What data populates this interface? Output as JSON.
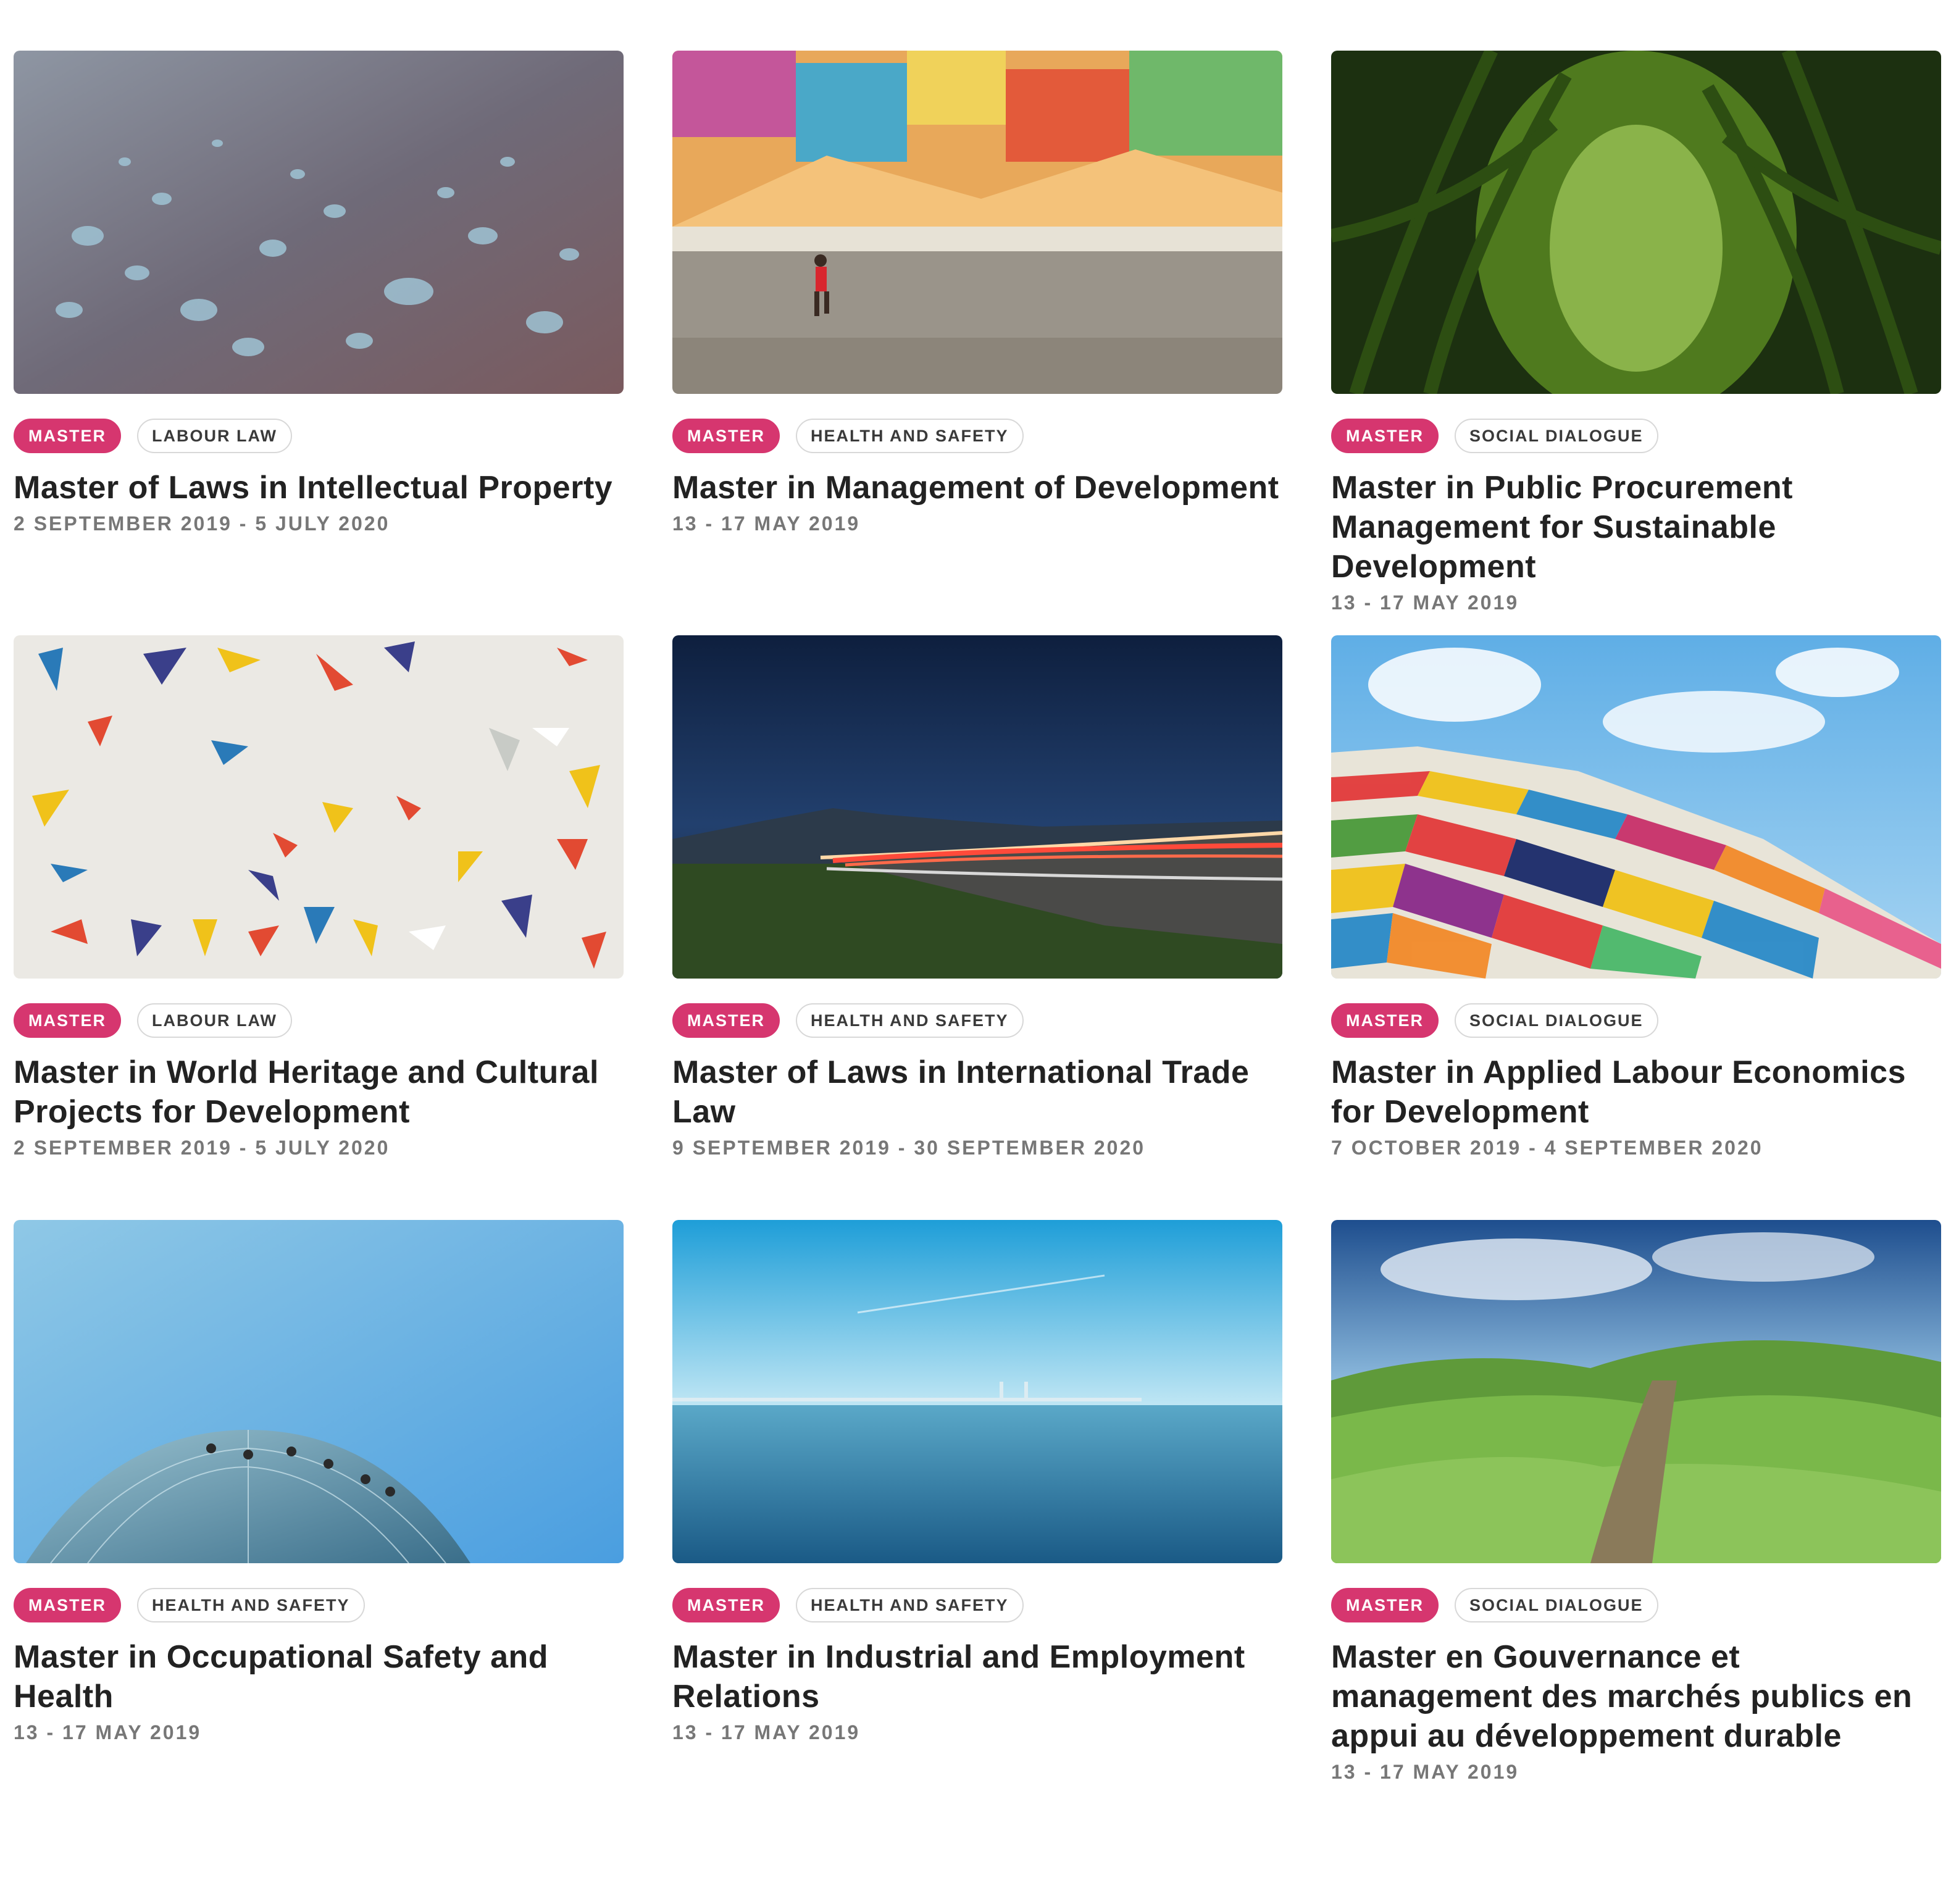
{
  "courses": [
    {
      "image": "water-droplets-image",
      "tags": [
        "MASTER",
        "LABOUR LAW"
      ],
      "title": "Master of Laws in Intellectual Property",
      "date": "2 SEPTEMBER 2019 - 5 JULY 2020"
    },
    {
      "image": "mural-runner-image",
      "tags": [
        "MASTER",
        "HEALTH AND SAFETY"
      ],
      "title": "Master in Management of Development",
      "date": "13 - 17 MAY 2019"
    },
    {
      "image": "corn-field-image",
      "tags": [
        "MASTER",
        "SOCIAL DIALOGUE"
      ],
      "title": "Master in Public Procurement Management for Sustainable Development",
      "date": "13 - 17 MAY 2019"
    },
    {
      "image": "paper-triangles-image",
      "tags": [
        "MASTER",
        "LABOUR LAW"
      ],
      "title": "Master in World Heritage and Cultural Projects for Development",
      "date": "2 SEPTEMBER 2019 - 5 JULY 2020"
    },
    {
      "image": "night-road-light-trails-image",
      "tags": [
        "MASTER",
        "HEALTH AND SAFETY"
      ],
      "title": "Master of Laws in International Trade Law",
      "date": "9 SEPTEMBER 2019 - 30 SEPTEMBER 2020"
    },
    {
      "image": "colorful-glass-roof-image",
      "tags": [
        "MASTER",
        "SOCIAL DIALOGUE"
      ],
      "title": "Master in Applied Labour Economics for Development",
      "date": "7 OCTOBER 2019 - 4 SEPTEMBER 2020"
    },
    {
      "image": "glass-dome-climbers-image",
      "tags": [
        "MASTER",
        "HEALTH AND SAFETY"
      ],
      "title": "Master in Occupational Safety and Health",
      "date": "13 - 17 MAY 2019"
    },
    {
      "image": "sea-bridge-image",
      "tags": [
        "MASTER",
        "HEALTH AND SAFETY"
      ],
      "title": "Master in Industrial and Employment Relations",
      "date": "13 - 17 MAY 2019"
    },
    {
      "image": "green-hills-path-image",
      "tags": [
        "MASTER",
        "SOCIAL DIALOGUE"
      ],
      "title": "Master en Gouvernance et management des marchés publics en appui au développement durable",
      "date": "13 - 17 MAY 2019"
    }
  ],
  "colors": {
    "accent": "#d6366f",
    "title": "#222222",
    "date": "#777777"
  }
}
